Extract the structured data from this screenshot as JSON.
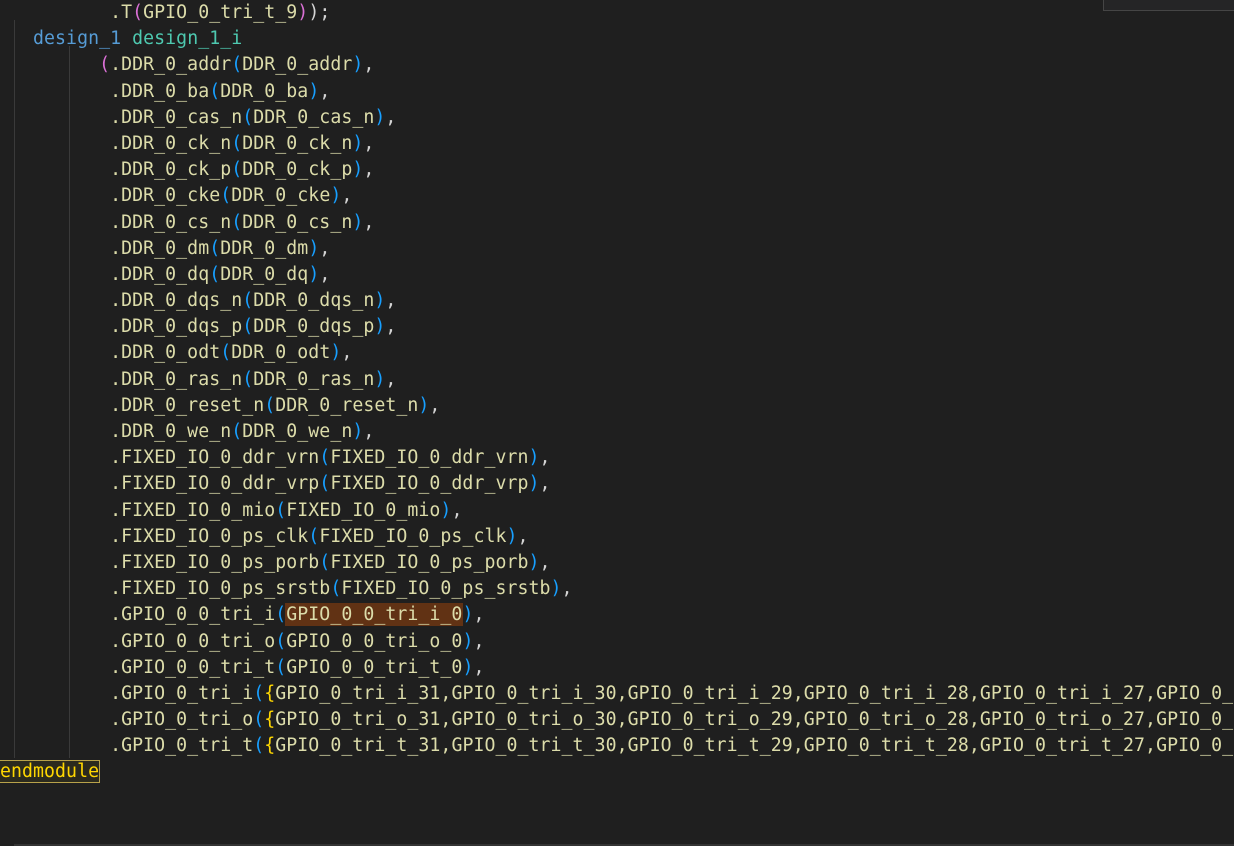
{
  "editor": {
    "lines": [
      {
        "indent": "          ",
        "parts": [
          {
            "t": ".T",
            "c": "t-port"
          },
          {
            "t": "(",
            "c": "t-paren-y"
          },
          {
            "t": "GPIO_0_tri_t_9",
            "c": "t-sig"
          },
          {
            "t": ")",
            "c": "t-paren-y"
          },
          {
            "t": ");",
            "c": "t-punct"
          }
        ]
      },
      {
        "indent": "   ",
        "parts": [
          {
            "t": "design_1",
            "c": "t-mod"
          },
          {
            "t": " ",
            "c": "t-punct"
          },
          {
            "t": "design_1_i",
            "c": "t-inst"
          }
        ]
      },
      {
        "indent": "         ",
        "parts": [
          {
            "t": "(",
            "c": "t-paren-y"
          },
          {
            "t": ".DDR_0_addr",
            "c": "t-port"
          },
          {
            "t": "(",
            "c": "t-paren"
          },
          {
            "t": "DDR_0_addr",
            "c": "t-sig"
          },
          {
            "t": ")",
            "c": "t-paren"
          },
          {
            "t": ",",
            "c": "t-punct"
          }
        ]
      },
      {
        "indent": "          ",
        "parts": [
          {
            "t": ".DDR_0_ba",
            "c": "t-port"
          },
          {
            "t": "(",
            "c": "t-paren"
          },
          {
            "t": "DDR_0_ba",
            "c": "t-sig"
          },
          {
            "t": ")",
            "c": "t-paren"
          },
          {
            "t": ",",
            "c": "t-punct"
          }
        ]
      },
      {
        "indent": "          ",
        "parts": [
          {
            "t": ".DDR_0_cas_n",
            "c": "t-port"
          },
          {
            "t": "(",
            "c": "t-paren"
          },
          {
            "t": "DDR_0_cas_n",
            "c": "t-sig"
          },
          {
            "t": ")",
            "c": "t-paren"
          },
          {
            "t": ",",
            "c": "t-punct"
          }
        ]
      },
      {
        "indent": "          ",
        "parts": [
          {
            "t": ".DDR_0_ck_n",
            "c": "t-port"
          },
          {
            "t": "(",
            "c": "t-paren"
          },
          {
            "t": "DDR_0_ck_n",
            "c": "t-sig"
          },
          {
            "t": ")",
            "c": "t-paren"
          },
          {
            "t": ",",
            "c": "t-punct"
          }
        ]
      },
      {
        "indent": "          ",
        "parts": [
          {
            "t": ".DDR_0_ck_p",
            "c": "t-port"
          },
          {
            "t": "(",
            "c": "t-paren"
          },
          {
            "t": "DDR_0_ck_p",
            "c": "t-sig"
          },
          {
            "t": ")",
            "c": "t-paren"
          },
          {
            "t": ",",
            "c": "t-punct"
          }
        ]
      },
      {
        "indent": "          ",
        "parts": [
          {
            "t": ".DDR_0_cke",
            "c": "t-port"
          },
          {
            "t": "(",
            "c": "t-paren"
          },
          {
            "t": "DDR_0_cke",
            "c": "t-sig"
          },
          {
            "t": ")",
            "c": "t-paren"
          },
          {
            "t": ",",
            "c": "t-punct"
          }
        ]
      },
      {
        "indent": "          ",
        "parts": [
          {
            "t": ".DDR_0_cs_n",
            "c": "t-port"
          },
          {
            "t": "(",
            "c": "t-paren"
          },
          {
            "t": "DDR_0_cs_n",
            "c": "t-sig"
          },
          {
            "t": ")",
            "c": "t-paren"
          },
          {
            "t": ",",
            "c": "t-punct"
          }
        ]
      },
      {
        "indent": "          ",
        "parts": [
          {
            "t": ".DDR_0_dm",
            "c": "t-port"
          },
          {
            "t": "(",
            "c": "t-paren"
          },
          {
            "t": "DDR_0_dm",
            "c": "t-sig"
          },
          {
            "t": ")",
            "c": "t-paren"
          },
          {
            "t": ",",
            "c": "t-punct"
          }
        ]
      },
      {
        "indent": "          ",
        "parts": [
          {
            "t": ".DDR_0_dq",
            "c": "t-port"
          },
          {
            "t": "(",
            "c": "t-paren"
          },
          {
            "t": "DDR_0_dq",
            "c": "t-sig"
          },
          {
            "t": ")",
            "c": "t-paren"
          },
          {
            "t": ",",
            "c": "t-punct"
          }
        ]
      },
      {
        "indent": "          ",
        "parts": [
          {
            "t": ".DDR_0_dqs_n",
            "c": "t-port"
          },
          {
            "t": "(",
            "c": "t-paren"
          },
          {
            "t": "DDR_0_dqs_n",
            "c": "t-sig"
          },
          {
            "t": ")",
            "c": "t-paren"
          },
          {
            "t": ",",
            "c": "t-punct"
          }
        ]
      },
      {
        "indent": "          ",
        "parts": [
          {
            "t": ".DDR_0_dqs_p",
            "c": "t-port"
          },
          {
            "t": "(",
            "c": "t-paren"
          },
          {
            "t": "DDR_0_dqs_p",
            "c": "t-sig"
          },
          {
            "t": ")",
            "c": "t-paren"
          },
          {
            "t": ",",
            "c": "t-punct"
          }
        ]
      },
      {
        "indent": "          ",
        "parts": [
          {
            "t": ".DDR_0_odt",
            "c": "t-port"
          },
          {
            "t": "(",
            "c": "t-paren"
          },
          {
            "t": "DDR_0_odt",
            "c": "t-sig"
          },
          {
            "t": ")",
            "c": "t-paren"
          },
          {
            "t": ",",
            "c": "t-punct"
          }
        ]
      },
      {
        "indent": "          ",
        "parts": [
          {
            "t": ".DDR_0_ras_n",
            "c": "t-port"
          },
          {
            "t": "(",
            "c": "t-paren"
          },
          {
            "t": "DDR_0_ras_n",
            "c": "t-sig"
          },
          {
            "t": ")",
            "c": "t-paren"
          },
          {
            "t": ",",
            "c": "t-punct"
          }
        ]
      },
      {
        "indent": "          ",
        "parts": [
          {
            "t": ".DDR_0_reset_n",
            "c": "t-port"
          },
          {
            "t": "(",
            "c": "t-paren"
          },
          {
            "t": "DDR_0_reset_n",
            "c": "t-sig"
          },
          {
            "t": ")",
            "c": "t-paren"
          },
          {
            "t": ",",
            "c": "t-punct"
          }
        ]
      },
      {
        "indent": "          ",
        "parts": [
          {
            "t": ".DDR_0_we_n",
            "c": "t-port"
          },
          {
            "t": "(",
            "c": "t-paren"
          },
          {
            "t": "DDR_0_we_n",
            "c": "t-sig"
          },
          {
            "t": ")",
            "c": "t-paren"
          },
          {
            "t": ",",
            "c": "t-punct"
          }
        ]
      },
      {
        "indent": "          ",
        "parts": [
          {
            "t": ".FIXED_IO_0_ddr_vrn",
            "c": "t-port"
          },
          {
            "t": "(",
            "c": "t-paren"
          },
          {
            "t": "FIXED_IO_0_ddr_vrn",
            "c": "t-sig"
          },
          {
            "t": ")",
            "c": "t-paren"
          },
          {
            "t": ",",
            "c": "t-punct"
          }
        ]
      },
      {
        "indent": "          ",
        "parts": [
          {
            "t": ".FIXED_IO_0_ddr_vrp",
            "c": "t-port"
          },
          {
            "t": "(",
            "c": "t-paren"
          },
          {
            "t": "FIXED_IO_0_ddr_vrp",
            "c": "t-sig"
          },
          {
            "t": ")",
            "c": "t-paren"
          },
          {
            "t": ",",
            "c": "t-punct"
          }
        ]
      },
      {
        "indent": "          ",
        "parts": [
          {
            "t": ".FIXED_IO_0_mio",
            "c": "t-port"
          },
          {
            "t": "(",
            "c": "t-paren"
          },
          {
            "t": "FIXED_IO_0_mio",
            "c": "t-sig"
          },
          {
            "t": ")",
            "c": "t-paren"
          },
          {
            "t": ",",
            "c": "t-punct"
          }
        ]
      },
      {
        "indent": "          ",
        "parts": [
          {
            "t": ".FIXED_IO_0_ps_clk",
            "c": "t-port"
          },
          {
            "t": "(",
            "c": "t-paren"
          },
          {
            "t": "FIXED_IO_0_ps_clk",
            "c": "t-sig"
          },
          {
            "t": ")",
            "c": "t-paren"
          },
          {
            "t": ",",
            "c": "t-punct"
          }
        ]
      },
      {
        "indent": "          ",
        "parts": [
          {
            "t": ".FIXED_IO_0_ps_porb",
            "c": "t-port"
          },
          {
            "t": "(",
            "c": "t-paren"
          },
          {
            "t": "FIXED_IO_0_ps_porb",
            "c": "t-sig"
          },
          {
            "t": ")",
            "c": "t-paren"
          },
          {
            "t": ",",
            "c": "t-punct"
          }
        ]
      },
      {
        "indent": "          ",
        "parts": [
          {
            "t": ".FIXED_IO_0_ps_srstb",
            "c": "t-port"
          },
          {
            "t": "(",
            "c": "t-paren"
          },
          {
            "t": "FIXED_IO_0_ps_srstb",
            "c": "t-sig"
          },
          {
            "t": ")",
            "c": "t-paren"
          },
          {
            "t": ",",
            "c": "t-punct"
          }
        ]
      },
      {
        "indent": "          ",
        "parts": [
          {
            "t": ".GPIO_0_0_tri_i",
            "c": "t-port"
          },
          {
            "t": "(",
            "c": "t-paren"
          },
          {
            "t": "GPIO_0_0_tri_i_0",
            "c": "t-sig hl"
          },
          {
            "t": ")",
            "c": "t-paren"
          },
          {
            "t": ",",
            "c": "t-punct"
          }
        ]
      },
      {
        "indent": "          ",
        "parts": [
          {
            "t": ".GPIO_0_0_tri_o",
            "c": "t-port"
          },
          {
            "t": "(",
            "c": "t-paren"
          },
          {
            "t": "GPIO_0_0_tri_o_0",
            "c": "t-sig"
          },
          {
            "t": ")",
            "c": "t-paren"
          },
          {
            "t": ",",
            "c": "t-punct"
          }
        ]
      },
      {
        "indent": "          ",
        "parts": [
          {
            "t": ".GPIO_0_0_tri_t",
            "c": "t-port"
          },
          {
            "t": "(",
            "c": "t-paren"
          },
          {
            "t": "GPIO_0_0_tri_t_0",
            "c": "t-sig"
          },
          {
            "t": ")",
            "c": "t-paren"
          },
          {
            "t": ",",
            "c": "t-punct"
          }
        ]
      },
      {
        "indent": "          ",
        "parts": [
          {
            "t": ".GPIO_0_tri_i",
            "c": "t-port"
          },
          {
            "t": "(",
            "c": "t-paren"
          },
          {
            "t": "{",
            "c": "t-brace"
          },
          {
            "t": "GPIO_0_tri_i_31,GPIO_0_tri_i_30,GPIO_0_tri_i_29,GPIO_0_tri_i_28,GPIO_0_tri_i_27,GPIO_0_",
            "c": "t-sig"
          }
        ]
      },
      {
        "indent": "          ",
        "parts": [
          {
            "t": ".GPIO_0_tri_o",
            "c": "t-port"
          },
          {
            "t": "(",
            "c": "t-paren"
          },
          {
            "t": "{",
            "c": "t-brace"
          },
          {
            "t": "GPIO_0_tri_o_31,GPIO_0_tri_o_30,GPIO_0_tri_o_29,GPIO_0_tri_o_28,GPIO_0_tri_o_27,GPIO_0_",
            "c": "t-sig"
          }
        ]
      },
      {
        "indent": "          ",
        "parts": [
          {
            "t": ".GPIO_0_tri_t",
            "c": "t-port"
          },
          {
            "t": "(",
            "c": "t-paren"
          },
          {
            "t": "{",
            "c": "t-brace"
          },
          {
            "t": "GPIO_0_tri_t_31,GPIO_0_tri_t_30,GPIO_0_tri_t_29,GPIO_0_tri_t_28,GPIO_0_tri_t_27,GPIO_0_",
            "c": "t-sig"
          }
        ]
      },
      {
        "indent": "",
        "parts": [
          {
            "t": "endmodule",
            "c": "t-kw kwbox"
          }
        ]
      }
    ]
  }
}
